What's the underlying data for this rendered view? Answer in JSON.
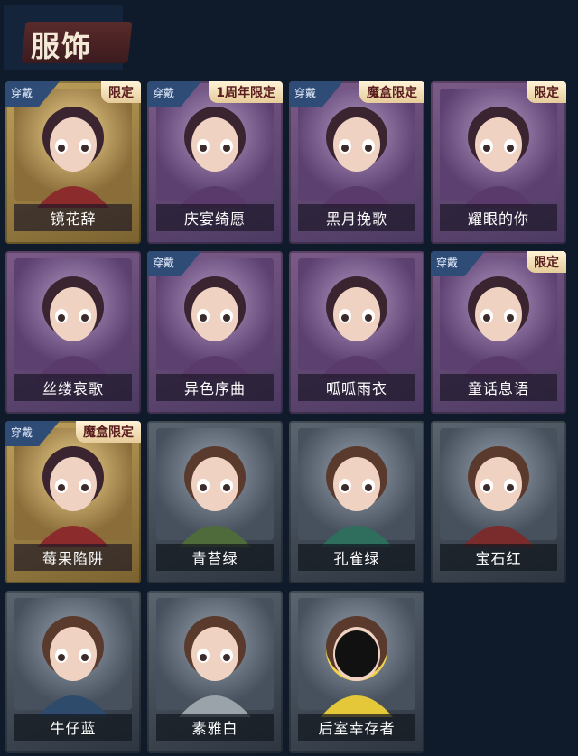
{
  "header": {
    "title": "服饰"
  },
  "tags": {
    "worn": "穿戴"
  },
  "items": [
    {
      "name": "镜花辞",
      "tier": "gold",
      "worn": true,
      "limit": "限定",
      "icon": "red-hood-girl-icon"
    },
    {
      "name": "庆宴绮愿",
      "tier": "purple",
      "worn": true,
      "limit": "1周年限定",
      "icon": "birthday-cake-boy-icon"
    },
    {
      "name": "黑月挽歌",
      "tier": "purple",
      "worn": true,
      "limit": "魔盒限定",
      "icon": "black-moon-girl-icon"
    },
    {
      "name": "耀眼的你",
      "tier": "purple",
      "worn": false,
      "limit": "限定",
      "icon": "cowboy-hat-girl-icon"
    },
    {
      "name": "丝缕哀歌",
      "tier": "purple",
      "worn": false,
      "limit": "",
      "icon": "floral-headdress-girl-icon"
    },
    {
      "name": "异色序曲",
      "tier": "purple",
      "worn": true,
      "limit": "",
      "icon": "top-hat-girl-icon"
    },
    {
      "name": "呱呱雨衣",
      "tier": "purple",
      "worn": false,
      "limit": "",
      "icon": "frog-raincoat-girl-icon"
    },
    {
      "name": "童话息语",
      "tier": "purple",
      "worn": true,
      "limit": "限定",
      "icon": "fairytale-girl-icon"
    },
    {
      "name": "莓果陷阱",
      "tier": "gold",
      "worn": true,
      "limit": "魔盒限定",
      "icon": "berry-hat-girl-icon"
    },
    {
      "name": "青苔绿",
      "tier": "gray",
      "worn": false,
      "limit": "",
      "icon": "green-hoodie-girl-icon"
    },
    {
      "name": "孔雀绿",
      "tier": "gray",
      "worn": false,
      "limit": "",
      "icon": "peacock-green-girl-icon"
    },
    {
      "name": "宝石红",
      "tier": "gray",
      "worn": false,
      "limit": "",
      "icon": "gem-red-girl-icon"
    },
    {
      "name": "牛仔蓝",
      "tier": "gray",
      "worn": false,
      "limit": "",
      "icon": "denim-blue-girl-icon"
    },
    {
      "name": "素雅白",
      "tier": "gray",
      "worn": false,
      "limit": "",
      "icon": "plain-white-girl-icon"
    },
    {
      "name": "后室幸存者",
      "tier": "gray",
      "worn": false,
      "limit": "",
      "icon": "gas-mask-survivor-icon"
    }
  ]
}
